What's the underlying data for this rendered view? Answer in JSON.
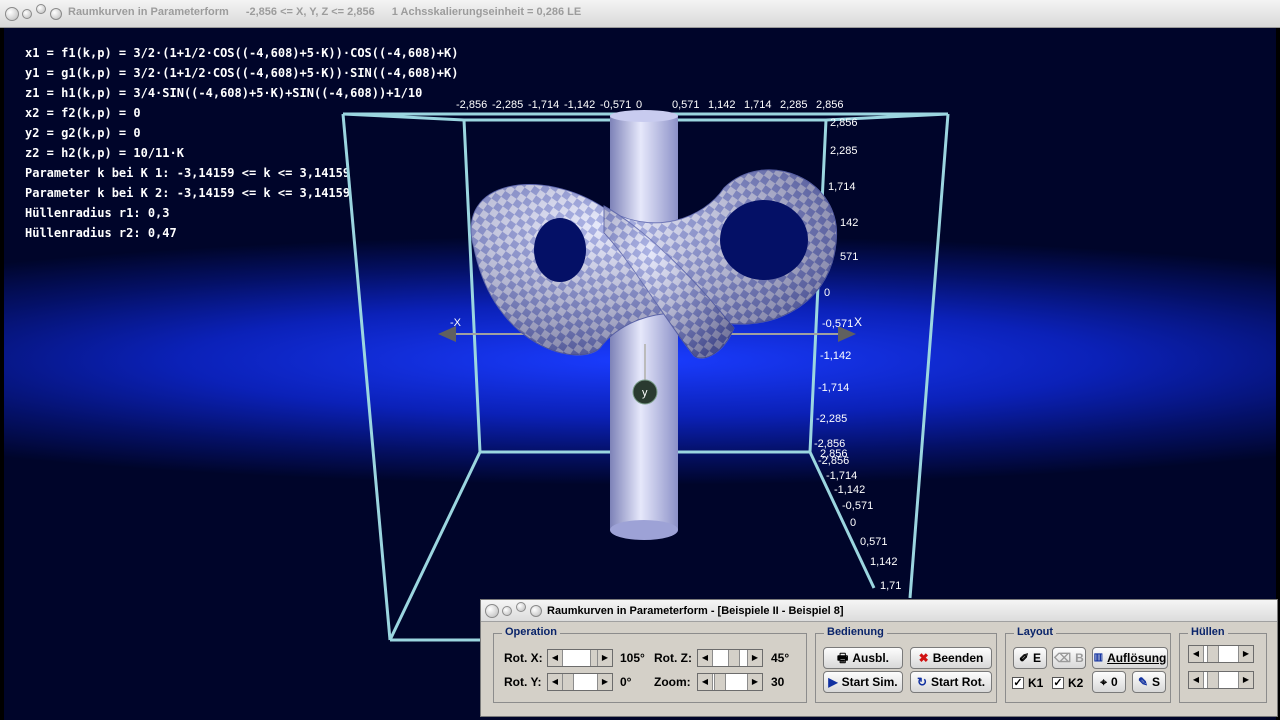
{
  "main_window": {
    "title": "Raumkurven in Parameterform",
    "range_text": "-2,856 <= X, Y, Z <= 2,856",
    "scale_text": "1 Achsskalierungseinheit = 0,286 LE"
  },
  "formulas": [
    "x1 = f1(k,p) = 3/2·(1+1/2·COS((-4,608)+5·K))·COS((-4,608)+K)",
    "y1 = g1(k,p) = 3/2·(1+1/2·COS((-4,608)+5·K))·SIN((-4,608)+K)",
    "z1 = h1(k,p) = 3/4·SIN((-4,608)+5·K)+SIN((-4,608))+1/10",
    "x2 = f2(k,p) = 0",
    "y2 = g2(k,p) = 0",
    "z2 = h2(k,p) = 10/11·K",
    "Parameter k bei K 1: -3,14159 <= k <= 3,14159",
    "Parameter k bei K 2: -3,14159 <= k <= 3,14159",
    "Hüllenradius r1: 0,3",
    "Hüllenradius r2: 0,47"
  ],
  "axes": {
    "top_ticks": [
      "-2,856",
      "-2,285",
      "-1,714",
      "-1,142",
      "-0,571",
      "0",
      "0,571",
      "1,142",
      "1,714",
      "2,285",
      "2,856"
    ],
    "right_ticks": [
      "2,856",
      "2,285",
      "1,714",
      "142",
      "571",
      "0",
      "-0,571",
      "-1,142",
      "-1,714",
      "-2,285",
      "-2,856"
    ],
    "depth_ticks": [
      "2,856",
      "-2,285",
      "-1,714",
      "-1,142",
      "-0,571",
      "0",
      "0,571",
      "1,142",
      "1,71"
    ],
    "x_pos_label": "X",
    "x_neg_label": "-X",
    "y_label": "y",
    "extra_tick": "-2,856"
  },
  "control_window": {
    "title": "Raumkurven in Parameterform - [Beispiele II - Beispiel 8]",
    "operation": {
      "legend": "Operation",
      "rot_x_label": "Rot. X:",
      "rot_x_value": "105°",
      "rot_z_label": "Rot. Z:",
      "rot_z_value": "45°",
      "rot_y_label": "Rot. Y:",
      "rot_y_value": "0°",
      "zoom_label": "Zoom:",
      "zoom_value": "30"
    },
    "bedienung": {
      "legend": "Bedienung",
      "ausbl": "Ausbl.",
      "beenden": "Beenden",
      "start_sim": "Start Sim.",
      "start_rot": "Start Rot."
    },
    "layout": {
      "legend": "Layout",
      "e_btn": "E",
      "b_btn": "B",
      "aufloesung": "Auflösung",
      "k1": "K1",
      "k2": "K2",
      "zero_btn": "0",
      "s_btn": "S"
    },
    "huellen": {
      "legend": "Hüllen"
    }
  },
  "colors": {
    "tube": "#aeb3e6",
    "checker_light": "#d9dcf7",
    "checker_dark": "#7f8ad6",
    "box": "#9bd6e0",
    "legend_text": "#0a246a"
  }
}
